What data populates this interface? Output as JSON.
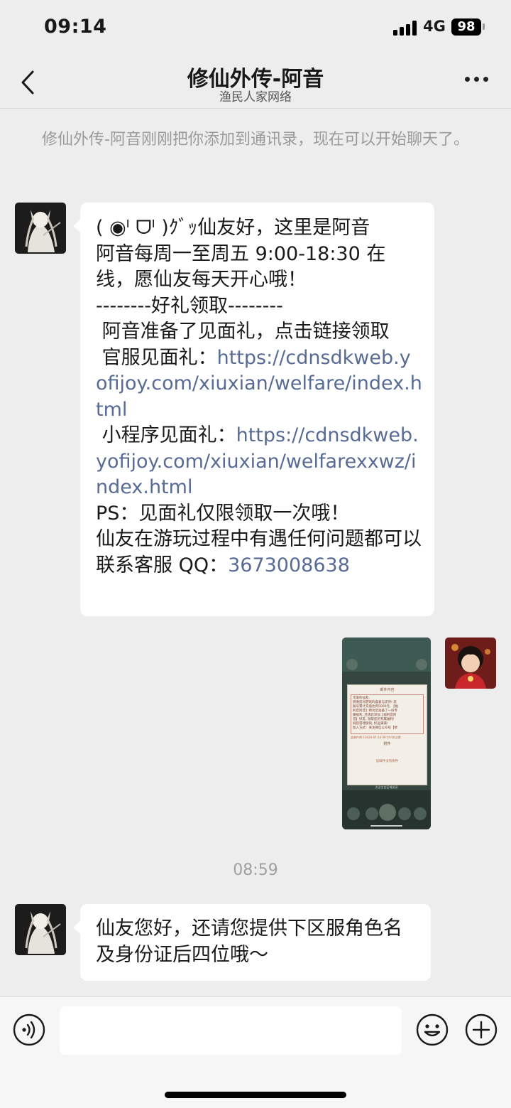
{
  "status_bar": {
    "time": "09:14",
    "network": "4G",
    "battery": "98"
  },
  "header": {
    "title": "修仙外传-阿音",
    "subtitle": "渔民人家网络"
  },
  "system_notice": "修仙外传-阿音刚刚把你添加到通讯录，现在可以开始聊天了。",
  "messages": [
    {
      "sender": "contact",
      "lines": [
        "( ◉ᴵ ᗜᴵ )ｸﾞｯ仙友好，这里是阿音",
        "阿音每周一至周五 9:00-18:30 在线，愿仙友每天开心哦！",
        "--------好礼领取--------",
        " 阿音准备了见面礼，点击链接领取"
      ],
      "official_label": " 官服见面礼：",
      "official_link": "https://cdnsdkweb.yofijoy.com/xiuxian/welfare/index.html",
      "mini_label": " 小程序见面礼：",
      "mini_link": "https://cdnsdkweb.yofijoy.com/xiuxian/welfarexxwz/index.html",
      "ps": "PS：见面礼仅限领取一次哦！",
      "contact_text": "仙友在游玩过程中有遇任何问题都可以联系客服 QQ：",
      "qq": "3673008638"
    },
    {
      "sender": "me",
      "image": {
        "mail_header": "邮件内容",
        "mail_lines": [
          "亲爱的仙友,",
          "感谢您对游戏的喜爱与支持! 您",
          "账号累计充值达到5000元, 【福",
          "利官阿音】特为您准备了一份专",
          "属福利, 还请您添加【福利官阿",
          "音】好友, 领取您的专属福利!",
          "祝您游戏愉快, 好运满满!",
          "加入方式：关注微信公众号【修"
        ],
        "mail_expiry": "此邮件将于2024-05-16 09:59:00过期",
        "attachment_label": "附件",
        "no_attachment": "该邮件没有附件",
        "bottom_button": "点击空白区域关闭"
      }
    }
  ],
  "time_separator": "08:59",
  "last_message": "仙友您好，还请您提供下区服角色名及身份证后四位哦～",
  "colors": {
    "background": "#ededed",
    "bubble": "#ffffff",
    "link": "#576b95",
    "input_bar": "#f6f6f6"
  }
}
